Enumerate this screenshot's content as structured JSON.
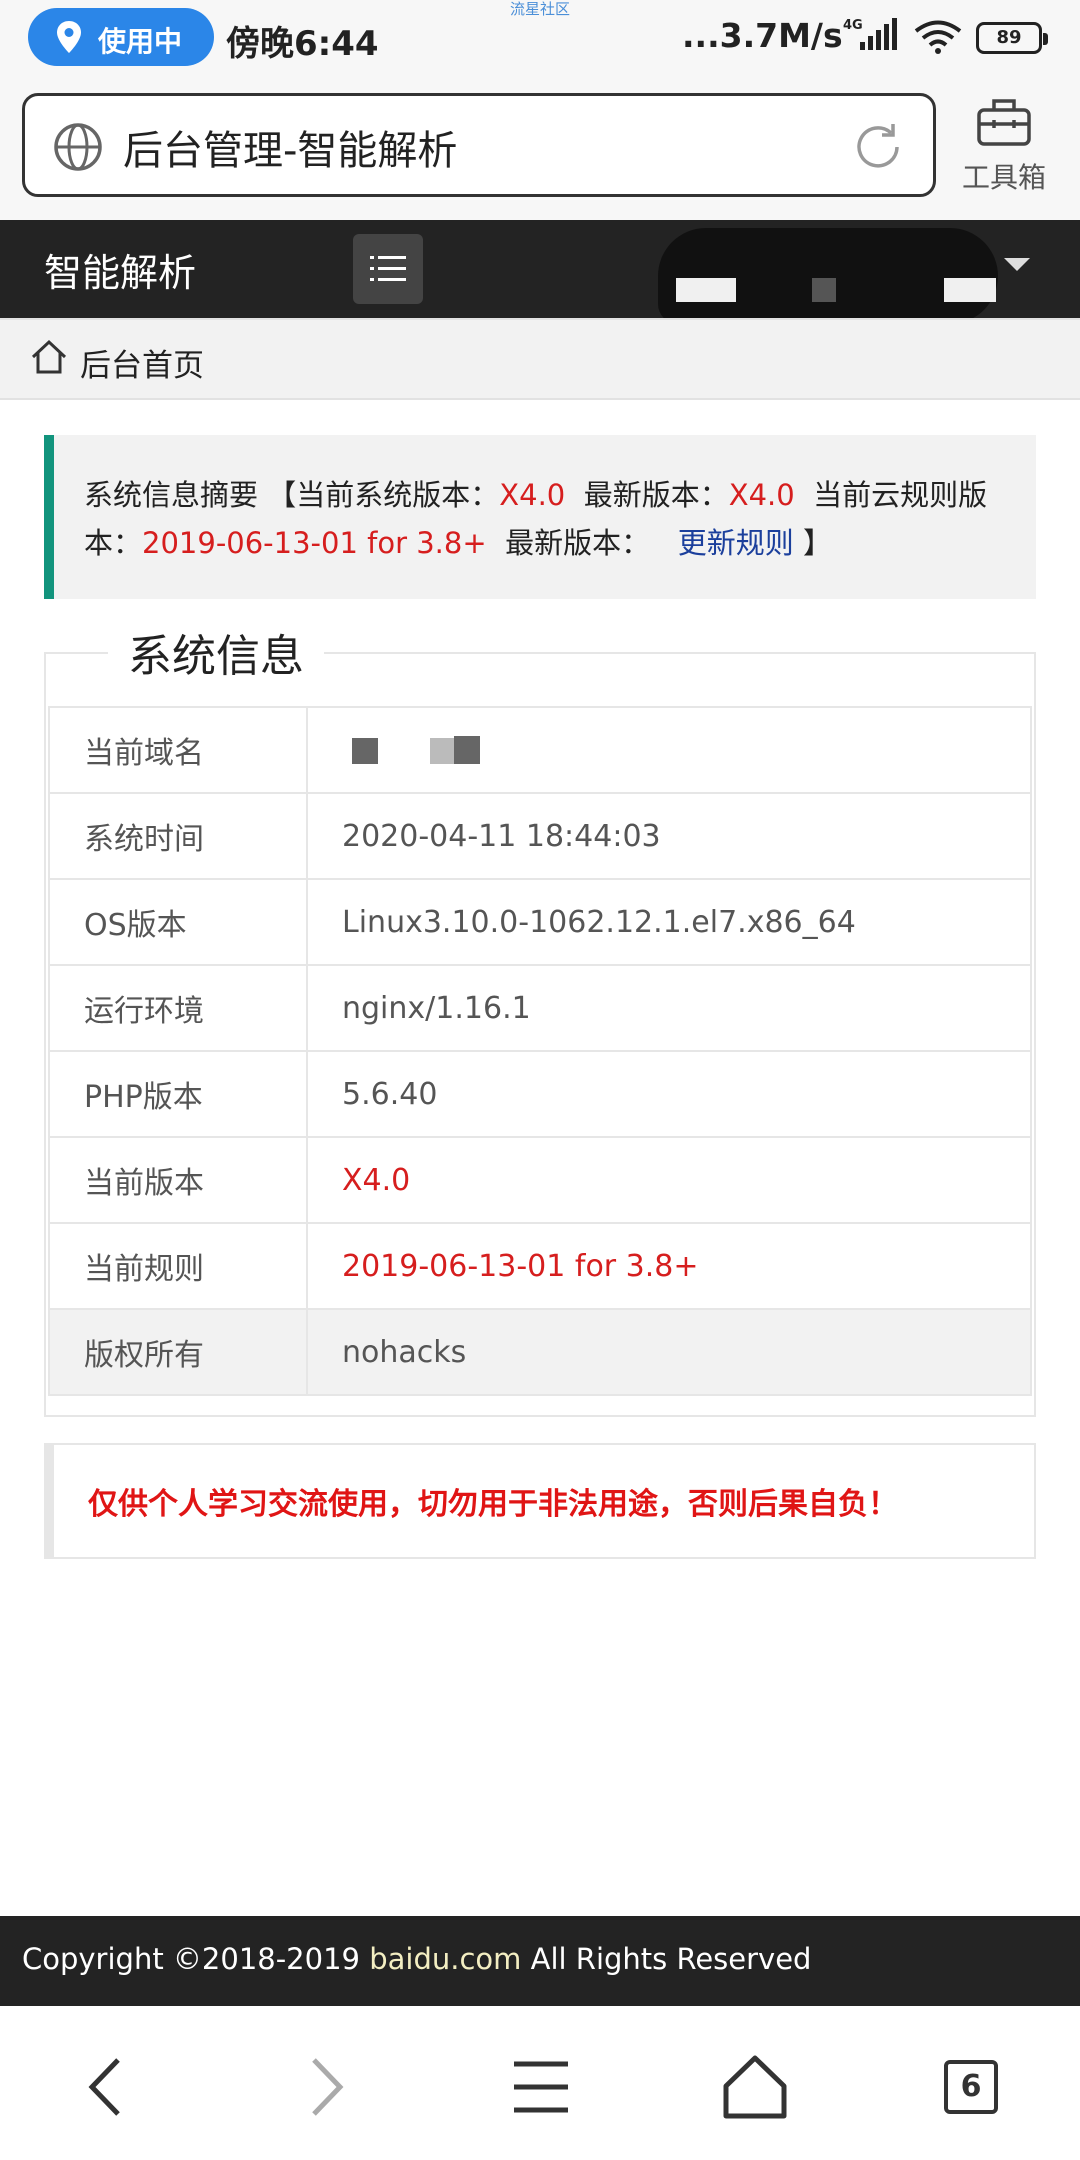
{
  "status_bar": {
    "location_pill": "使用中",
    "time": "傍晚6:44",
    "watermark": "流星社区",
    "net_speed": "...3.7M/s",
    "net_type": "4G",
    "battery": "89"
  },
  "browser": {
    "url_title": "后台管理-智能解析",
    "toolbox_label": "工具箱"
  },
  "header": {
    "app_title": "智能解析"
  },
  "breadcrumb": {
    "home": "后台首页"
  },
  "summary": {
    "label": "系统信息摘要",
    "open_bracket": "【",
    "current_system_version_label": "当前系统版本：",
    "current_system_version": "X4.0",
    "latest_version_label": "最新版本：",
    "latest_version": "X4.0",
    "current_rule_version_label": "当前云规则版本：",
    "current_rule_version": "2019-06-13-01 for 3.8+",
    "latest_rule_label": "最新版本：",
    "update_link": "更新规则",
    "close_bracket": "】"
  },
  "system_info": {
    "legend": "系统信息",
    "rows": [
      {
        "key": "当前域名",
        "value": ""
      },
      {
        "key": "系统时间",
        "value": "2020-04-11 18:44:03"
      },
      {
        "key": "OS版本",
        "value": "Linux3.10.0-1062.12.1.el7.x86_64"
      },
      {
        "key": "运行环境",
        "value": "nginx/1.16.1"
      },
      {
        "key": "PHP版本",
        "value": "5.6.40"
      },
      {
        "key": "当前版本",
        "value": "X4.0"
      },
      {
        "key": "当前规则",
        "value": "2019-06-13-01 for 3.8+"
      },
      {
        "key": "版权所有",
        "value": "nohacks"
      }
    ]
  },
  "warning": "仅供个人学习交流使用，切勿用于非法用途，否则后果自负！",
  "footer": {
    "copyright_prefix": "Copyright ©2018-2019 ",
    "brand": "baidu.com",
    "copyright_suffix": " All Rights Reserved"
  },
  "bottom_nav": {
    "tab_count": "6"
  },
  "colors": {
    "accent_green": "#12947d",
    "highlight_red": "#d61e1e",
    "link_blue": "#1b3f9c",
    "dark_bar": "#232323",
    "pill_blue": "#2b86e8"
  }
}
